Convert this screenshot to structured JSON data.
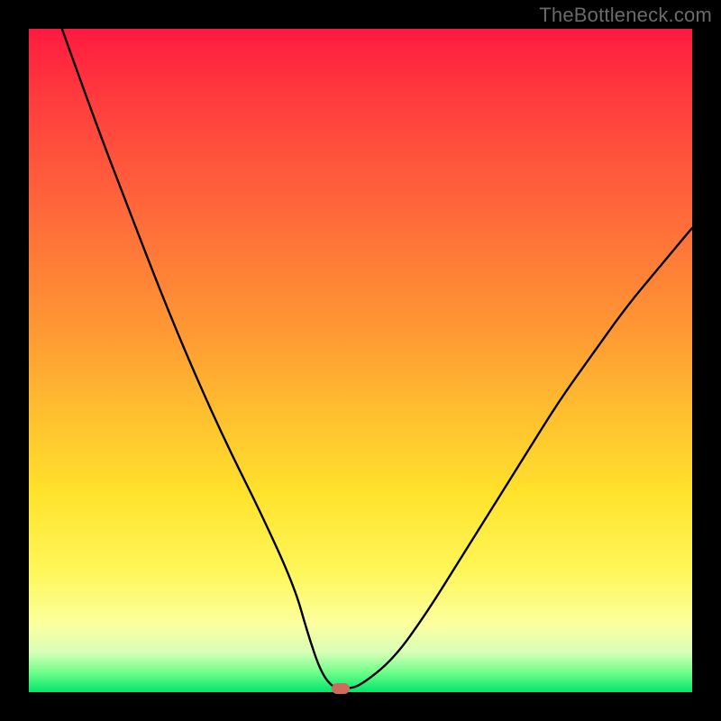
{
  "watermark": "TheBottleneck.com",
  "colors": {
    "background": "#000000",
    "curve_stroke": "#000000",
    "dot": "#d06a5a",
    "gradient_top": "#ff1a3f",
    "gradient_bottom": "#00e66a"
  },
  "chart_data": {
    "type": "line",
    "title": "",
    "xlabel": "",
    "ylabel": "",
    "xlim": [
      0,
      100
    ],
    "ylim": [
      0,
      100
    ],
    "grid": false,
    "legend": false,
    "series": [
      {
        "name": "bottleneck-curve",
        "x": [
          5,
          10,
          15,
          20,
          25,
          30,
          35,
          40,
          42,
          44,
          46,
          48,
          50,
          55,
          60,
          65,
          70,
          75,
          80,
          85,
          90,
          95,
          100
        ],
        "values": [
          100,
          86,
          73,
          60,
          48,
          37,
          27,
          16,
          9,
          3,
          0.5,
          0.5,
          1,
          5,
          12,
          20,
          28,
          36,
          44,
          51,
          58,
          64,
          70
        ]
      }
    ],
    "annotations": [
      {
        "name": "minimum-marker",
        "x": 47,
        "y": 0.5
      }
    ]
  }
}
